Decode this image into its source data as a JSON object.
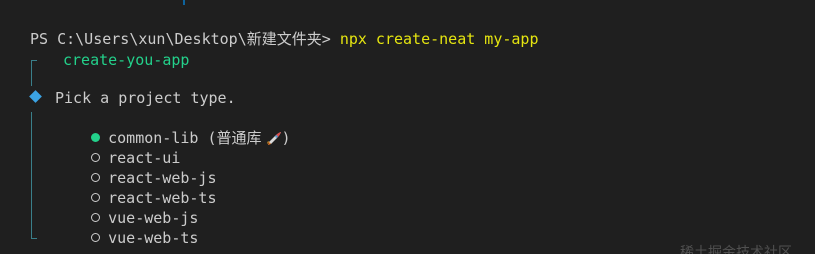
{
  "terminal": {
    "prompt": "PS C:\\Users\\xun\\Desktop\\新建文件夹> ",
    "command": "npx create-neat my-app",
    "app_name": "create-you-app",
    "question": "Pick a project type.",
    "options": [
      {
        "label": "common-lib (普通库",
        "suffix": ")",
        "selected": true,
        "emoji": "rocket-icon"
      },
      {
        "label": "react-ui",
        "selected": false
      },
      {
        "label": "react-web-js",
        "selected": false
      },
      {
        "label": "react-web-ts",
        "selected": false
      },
      {
        "label": "vue-web-js",
        "selected": false
      },
      {
        "label": "vue-web-ts",
        "selected": false
      }
    ],
    "watermark": "稀土掘金技术社区"
  },
  "colors": {
    "background": "#1f1f1f",
    "text": "#cccccc",
    "command": "#e5e510",
    "green": "#23d18b",
    "blue": "#3ba3e3",
    "gutter": "#3a7f8a"
  }
}
